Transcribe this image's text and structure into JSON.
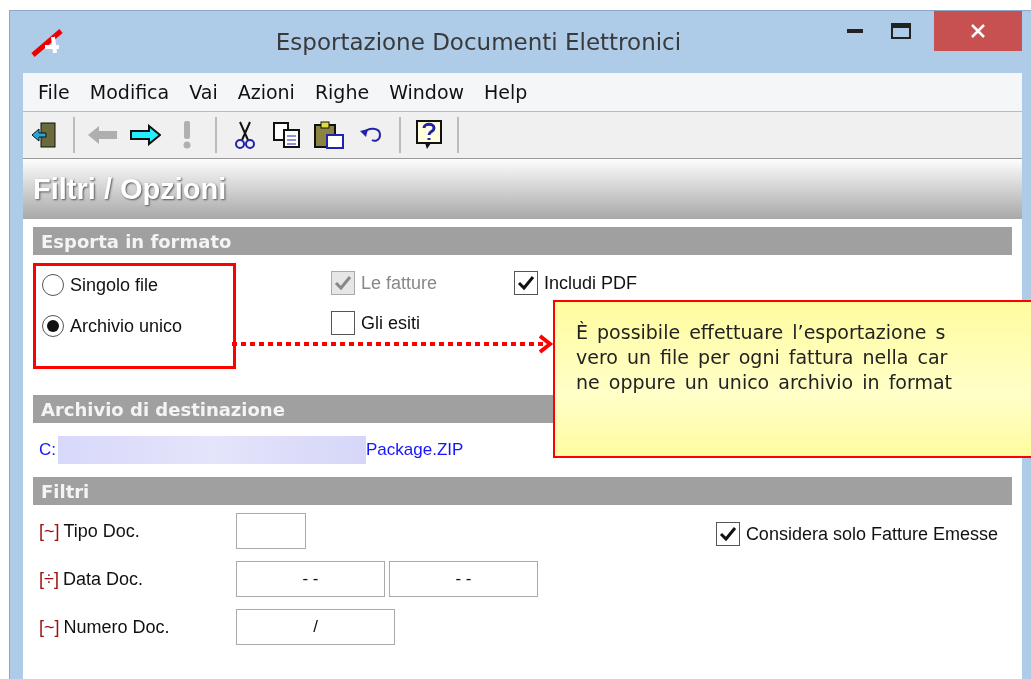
{
  "window": {
    "title": "Esportazione Documenti Elettronici"
  },
  "menu": [
    {
      "label": "File"
    },
    {
      "label": "Modifica"
    },
    {
      "label": "Vai"
    },
    {
      "label": "Azioni"
    },
    {
      "label": "Righe"
    },
    {
      "label": "Window"
    },
    {
      "label": "Help"
    }
  ],
  "toolbar": [
    {
      "kind": "exit",
      "disabled": false
    },
    {
      "kind": "separator"
    },
    {
      "kind": "back",
      "disabled": true
    },
    {
      "kind": "forward",
      "disabled": false
    },
    {
      "kind": "alert",
      "disabled": true
    },
    {
      "kind": "separator"
    },
    {
      "kind": "cut",
      "disabled": false
    },
    {
      "kind": "copy",
      "disabled": false
    },
    {
      "kind": "paste",
      "disabled": false
    },
    {
      "kind": "undo",
      "disabled": false
    },
    {
      "kind": "separator"
    },
    {
      "kind": "help",
      "disabled": false
    },
    {
      "kind": "separator"
    }
  ],
  "panel_title": "Filtri / Opzioni",
  "export_format": {
    "title": "Esporta in formato",
    "radios": [
      {
        "label": "Singolo file",
        "selected": false
      },
      {
        "label": "Archivio unico",
        "selected": true
      }
    ],
    "checkboxes": [
      {
        "label": "Le fatture",
        "checked": true,
        "disabled": true
      },
      {
        "label": "Includi PDF",
        "checked": true,
        "disabled": false
      },
      {
        "label": "Gli esiti",
        "checked": false,
        "disabled": false
      }
    ]
  },
  "destination": {
    "title": "Archivio di destinazione",
    "path_start": "C:",
    "path_end": "Package.ZIP"
  },
  "filters": {
    "title": "Filtri",
    "rows": [
      {
        "marker": "[~]",
        "label": "Tipo Doc.",
        "fields": [
          {
            "kind": "code"
          }
        ]
      },
      {
        "marker": "[÷]",
        "label": "Data Doc.",
        "fields": [
          {
            "kind": "date",
            "value": "- -"
          },
          {
            "kind": "date",
            "value": "- -"
          }
        ]
      },
      {
        "marker": "[~]",
        "label": "Numero Doc.",
        "fields": [
          {
            "kind": "number",
            "value": "/"
          }
        ]
      }
    ],
    "option": {
      "label": "Considera solo Fatture Emesse",
      "checked": true
    }
  },
  "callout": {
    "lines": [
      "È possibile effettuare l’esportazione s",
      "vero un file per ogni fattura nella car",
      "ne oppure un unico archivio in format"
    ]
  }
}
